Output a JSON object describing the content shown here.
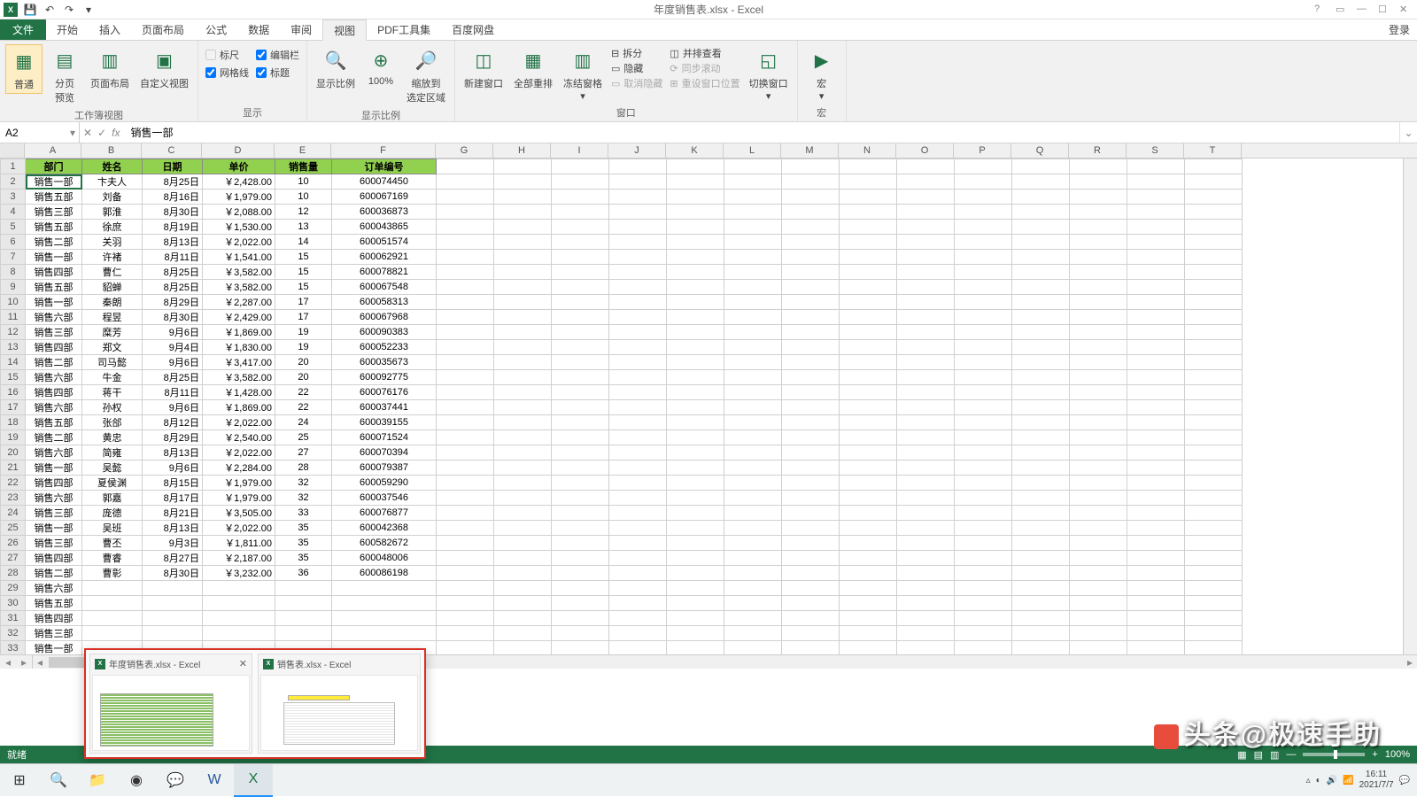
{
  "title": "年度销售表.xlsx - Excel",
  "login_label": "登录",
  "tabs": {
    "file": "文件",
    "items": [
      "开始",
      "插入",
      "页面布局",
      "公式",
      "数据",
      "审阅",
      "视图",
      "PDF工具集",
      "百度网盘"
    ],
    "active_index": 6
  },
  "ribbon": {
    "group_views": {
      "label": "工作簿视图",
      "normal": "普通",
      "page_break": "分页\n预览",
      "page_layout": "页面布局",
      "custom_views": "自定义视图"
    },
    "group_show": {
      "label": "显示",
      "ruler": "标尺",
      "formula_bar": "编辑栏",
      "gridlines": "网格线",
      "headings": "标题"
    },
    "group_zoom": {
      "label": "显示比例",
      "zoom": "显示比例",
      "hundred": "100%",
      "zoom_sel": "缩放到\n选定区域"
    },
    "group_window": {
      "label": "窗口",
      "new_window": "新建窗口",
      "arrange": "全部重排",
      "freeze": "冻结窗格",
      "split": "拆分",
      "hide": "隐藏",
      "unhide": "取消隐藏",
      "side_by_side": "并排查看",
      "sync_scroll": "同步滚动",
      "reset_pos": "重设窗口位置",
      "switch": "切换窗口"
    },
    "group_macros": {
      "label": "宏",
      "macros": "宏"
    }
  },
  "namebox": "A2",
  "formula_value": "销售一部",
  "headers": [
    "部门",
    "姓名",
    "日期",
    "单价",
    "销售量",
    "订单编号"
  ],
  "rows": [
    [
      "销售一部",
      "卞夫人",
      "8月25日",
      "￥2,428.00",
      "10",
      "600074450"
    ],
    [
      "销售五部",
      "刘备",
      "8月16日",
      "￥1,979.00",
      "10",
      "600067169"
    ],
    [
      "销售三部",
      "郭淮",
      "8月30日",
      "￥2,088.00",
      "12",
      "600036873"
    ],
    [
      "销售五部",
      "徐庶",
      "8月19日",
      "￥1,530.00",
      "13",
      "600043865"
    ],
    [
      "销售二部",
      "关羽",
      "8月13日",
      "￥2,022.00",
      "14",
      "600051574"
    ],
    [
      "销售一部",
      "许褚",
      "8月11日",
      "￥1,541.00",
      "15",
      "600062921"
    ],
    [
      "销售四部",
      "曹仁",
      "8月25日",
      "￥3,582.00",
      "15",
      "600078821"
    ],
    [
      "销售五部",
      "貂蝉",
      "8月25日",
      "￥3,582.00",
      "15",
      "600067548"
    ],
    [
      "销售一部",
      "秦朗",
      "8月29日",
      "￥2,287.00",
      "17",
      "600058313"
    ],
    [
      "销售六部",
      "程昱",
      "8月30日",
      "￥2,429.00",
      "17",
      "600067968"
    ],
    [
      "销售三部",
      "糜芳",
      "9月6日",
      "￥1,869.00",
      "19",
      "600090383"
    ],
    [
      "销售四部",
      "郑文",
      "9月4日",
      "￥1,830.00",
      "19",
      "600052233"
    ],
    [
      "销售二部",
      "司马懿",
      "9月6日",
      "￥3,417.00",
      "20",
      "600035673"
    ],
    [
      "销售六部",
      "牛金",
      "8月25日",
      "￥3,582.00",
      "20",
      "600092775"
    ],
    [
      "销售四部",
      "蒋干",
      "8月11日",
      "￥1,428.00",
      "22",
      "600076176"
    ],
    [
      "销售六部",
      "孙权",
      "9月6日",
      "￥1,869.00",
      "22",
      "600037441"
    ],
    [
      "销售五部",
      "张郃",
      "8月12日",
      "￥2,022.00",
      "24",
      "600039155"
    ],
    [
      "销售二部",
      "黄忠",
      "8月29日",
      "￥2,540.00",
      "25",
      "600071524"
    ],
    [
      "销售六部",
      "简雍",
      "8月13日",
      "￥2,022.00",
      "27",
      "600070394"
    ],
    [
      "销售一部",
      "吴懿",
      "9月6日",
      "￥2,284.00",
      "28",
      "600079387"
    ],
    [
      "销售四部",
      "夏侯渊",
      "8月15日",
      "￥1,979.00",
      "32",
      "600059290"
    ],
    [
      "销售六部",
      "郭嘉",
      "8月17日",
      "￥1,979.00",
      "32",
      "600037546"
    ],
    [
      "销售三部",
      "庞德",
      "8月21日",
      "￥3,505.00",
      "33",
      "600076877"
    ],
    [
      "销售一部",
      "吴班",
      "8月13日",
      "￥2,022.00",
      "35",
      "600042368"
    ],
    [
      "销售三部",
      "曹丕",
      "9月3日",
      "￥1,811.00",
      "35",
      "600582672"
    ],
    [
      "销售四部",
      "曹睿",
      "8月27日",
      "￥2,187.00",
      "35",
      "600048006"
    ],
    [
      "销售二部",
      "曹彰",
      "8月30日",
      "￥3,232.00",
      "36",
      "600086198"
    ],
    [
      "销售六部",
      "",
      "",
      "",
      "",
      ""
    ],
    [
      "销售五部",
      "",
      "",
      "",
      "",
      ""
    ],
    [
      "销售四部",
      "",
      "",
      "",
      "",
      ""
    ],
    [
      "销售三部",
      "",
      "",
      "",
      "",
      ""
    ],
    [
      "销售一部",
      "",
      "",
      "",
      "",
      ""
    ],
    [
      "",
      "",
      "",
      "",
      "",
      ""
    ]
  ],
  "cols": [
    "A",
    "B",
    "C",
    "D",
    "E",
    "F",
    "G",
    "H",
    "I",
    "J",
    "K",
    "L",
    "M",
    "N",
    "O",
    "P",
    "Q",
    "R",
    "S",
    "T"
  ],
  "status": {
    "ready": "就绪",
    "zoom": "100%"
  },
  "switcher": {
    "win1": "年度销售表.xlsx - Excel",
    "win2": "销售表.xlsx - Excel"
  },
  "tray": {
    "time": "16:11",
    "date": "2021/7/7"
  },
  "watermark": "头条@极速手助"
}
